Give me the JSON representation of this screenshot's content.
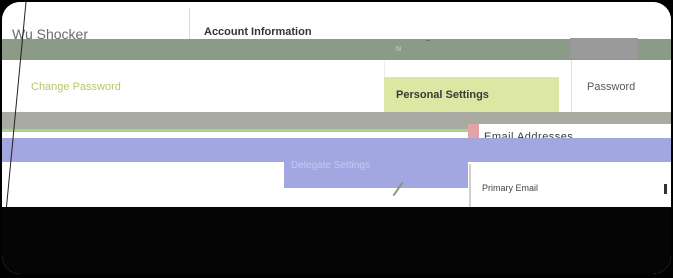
{
  "header": {
    "user_name": "Wu Shocker",
    "section_title": "Account Information",
    "marker": "N"
  },
  "nav": {
    "change_password": "Change Password",
    "personal_settings": "Personal Settings",
    "password": "Password"
  },
  "content": {
    "email_addresses_heading": "Email Addresses",
    "primary_email_label": "Primary Email",
    "faint_blue_label": "Delegate Settings"
  },
  "colors": {
    "active_tab": "#dbe7a3",
    "accent_blue": "#a2a7e2",
    "accent_pink": "#e4a3a7",
    "accent_green": "#a7d391"
  }
}
